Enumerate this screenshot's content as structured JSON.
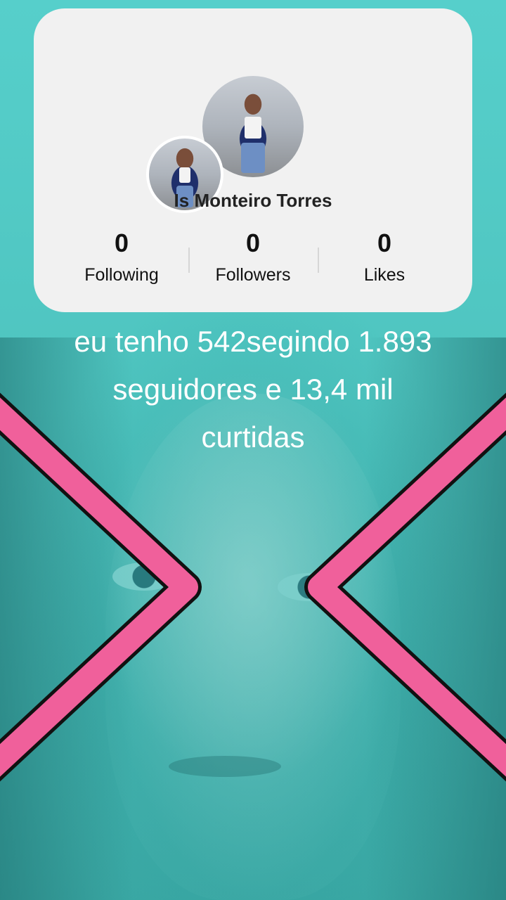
{
  "profile": {
    "name": "Is  Monteiro Torres",
    "stats": [
      {
        "value": "0",
        "label": "Following"
      },
      {
        "value": "0",
        "label": "Followers"
      },
      {
        "value": "0",
        "label": "Likes"
      }
    ]
  },
  "caption": {
    "lines": [
      "eu tenho 542segindo 1.893",
      "seguidores e 13,4 mil",
      "curtidas"
    ]
  },
  "colors": {
    "background": "#56cfcb",
    "card": "#f1f1f1",
    "chevron": "#f0609b",
    "caption_text": "#ffffff"
  },
  "icons": [
    "chevron-right-icon",
    "chevron-left-icon"
  ]
}
